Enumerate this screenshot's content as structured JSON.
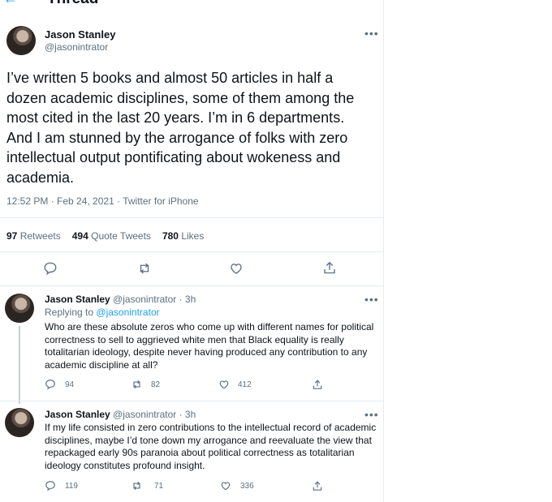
{
  "header": {
    "title": "Thread"
  },
  "main_tweet": {
    "name": "Jason Stanley",
    "handle": "@jasonintrator",
    "text": "I’ve written 5 books and almost 50 articles in half a dozen academic disciplines, some of them among the most cited in the last 20 years. I’m in 6 departments. And I am stunned by the arrogance of folks with zero intellectual output pontificating about wokeness and academia.",
    "meta": "12:52 PM · Feb 24, 2021 · Twitter for iPhone",
    "stats": {
      "retweets_count": "97",
      "retweets_label": "Retweets",
      "quotes_count": "494",
      "quotes_label": "Quote Tweets",
      "likes_count": "780",
      "likes_label": "Likes"
    }
  },
  "replies": [
    {
      "name": "Jason Stanley",
      "handle_time": "@jasonintrator · 3h",
      "replying_label": "Replying to",
      "replying_handle": "@jasonintrator",
      "text": "Who are these absolute zeros who come up with different names for political correctness to sell to aggrieved white men that Black equality is really totalitarian ideology, despite never having produced any contribution to any academic discipline at all?",
      "reply_count": "94",
      "retweet_count": "82",
      "like_count": "412"
    },
    {
      "name": "Jason Stanley",
      "handle_time": "@jasonintrator · 3h",
      "text": "If my life consisted in zero contributions to the intellectual record of academic disciplines, maybe I’d tone down my arrogance and reevaluate the view that repackaged early 90s paranoia about political correctness as totalitarian ideology constitutes profound insight.",
      "reply_count": "119",
      "retweet_count": "71",
      "like_count": "336"
    }
  ],
  "colors": {
    "accent": "#1da1f2",
    "muted": "#5b7083",
    "divider": "#e6ecf0"
  }
}
